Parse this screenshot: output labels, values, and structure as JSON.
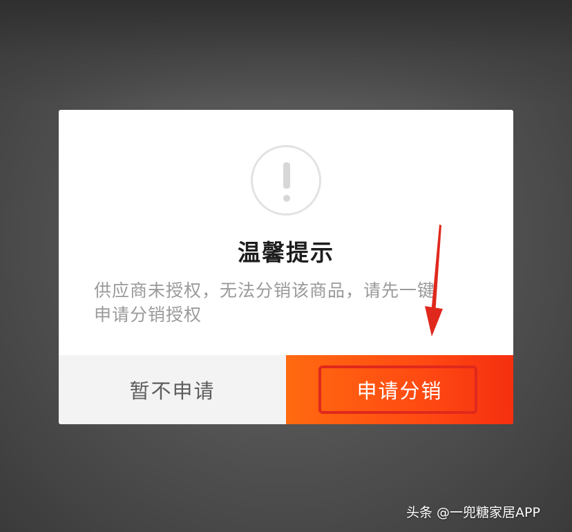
{
  "dialog": {
    "title": "温馨提示",
    "message_line1": "供应商未授权，无法分销该商品，请先一键",
    "message_line2": "申请分销授权",
    "cancel_label": "暂不申请",
    "apply_label": "申请分销"
  },
  "icons": {
    "warning": "exclamation-circle-icon",
    "annotation": "red-arrow-down-icon"
  },
  "watermark": "头条 @一兜糖家居APP",
  "colors": {
    "accent": "#ff5a12",
    "annotation": "#e0281c",
    "cancel_bg": "#f3f3f3",
    "title_text": "#1d1d1d",
    "message_text": "#9a9a9a"
  }
}
